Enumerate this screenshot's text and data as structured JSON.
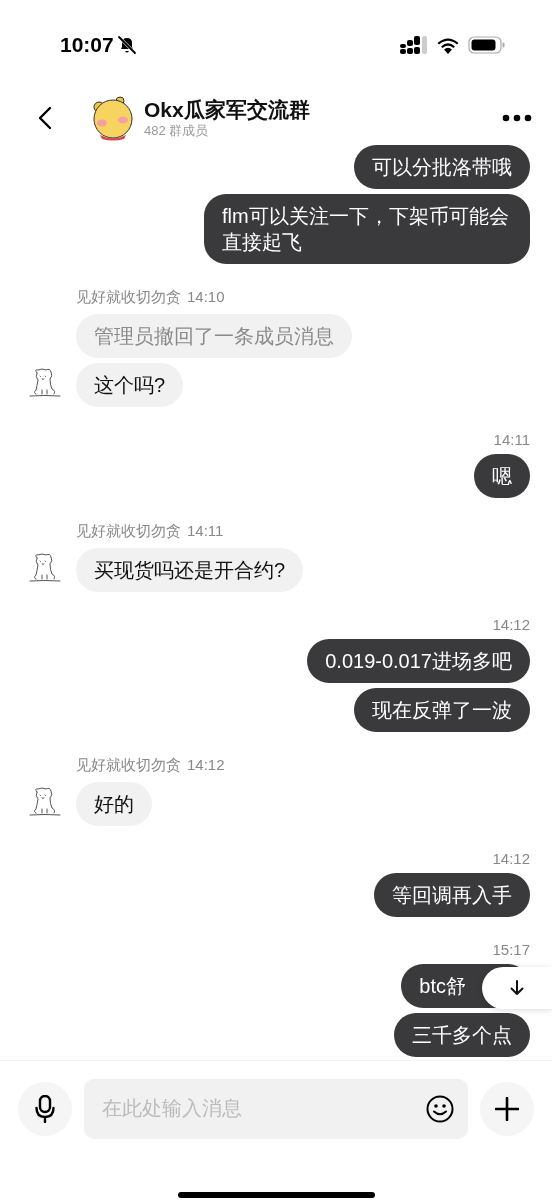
{
  "status_bar": {
    "time": "10:07",
    "muted": true
  },
  "header": {
    "title": "Okx瓜家军交流群",
    "subtitle": "482 群成员"
  },
  "messages": [
    {
      "kind": "outgoing",
      "bubbles": [
        {
          "text": "可以分批洛带哦"
        },
        {
          "text": "flm可以关注一下，下架币可能会直接起飞"
        }
      ]
    },
    {
      "kind": "incoming",
      "sender": "见好就收切勿贪",
      "time": "14:10",
      "bubbles": [
        {
          "text": "管理员撤回了一条成员消息",
          "recalled": true
        },
        {
          "text": "这个吗?",
          "recalled": false
        }
      ]
    },
    {
      "kind": "outgoing",
      "time": "14:11",
      "bubbles": [
        {
          "text": "嗯"
        }
      ]
    },
    {
      "kind": "incoming",
      "sender": "见好就收切勿贪",
      "time": "14:11",
      "bubbles": [
        {
          "text": "买现货吗还是开合约?",
          "recalled": false
        }
      ]
    },
    {
      "kind": "outgoing",
      "time": "14:12",
      "bubbles": [
        {
          "text": "0.019-0.017进场多吧"
        },
        {
          "text": "现在反弹了一波"
        }
      ]
    },
    {
      "kind": "incoming",
      "sender": "见好就收切勿贪",
      "time": "14:12",
      "bubbles": [
        {
          "text": "好的",
          "recalled": false
        }
      ]
    },
    {
      "kind": "outgoing",
      "time": "14:12",
      "bubbles": [
        {
          "text": "等回调再入手"
        }
      ]
    },
    {
      "kind": "outgoing",
      "time": "15:17",
      "bubbles": [
        {
          "text": "btc舒",
          "covered": true
        },
        {
          "text": "三千多个点"
        }
      ]
    }
  ],
  "composer": {
    "placeholder": "在此处输入消息"
  }
}
